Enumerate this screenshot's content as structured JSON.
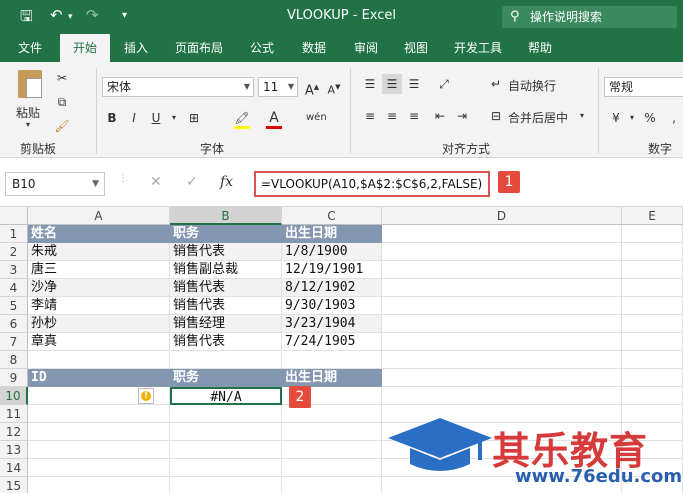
{
  "titlebar": {
    "title": "VLOOKUP  -  Excel",
    "search_placeholder": "操作说明搜索"
  },
  "tabs": [
    "文件",
    "开始",
    "插入",
    "页面布局",
    "公式",
    "数据",
    "审阅",
    "视图",
    "开发工具",
    "帮助"
  ],
  "active_tab": "开始",
  "ribbon": {
    "clipboard": {
      "paste_label": "粘贴",
      "group_label": "剪贴板"
    },
    "font": {
      "font_name": "宋体",
      "font_size": "11",
      "bold": "B",
      "italic": "I",
      "underline": "U",
      "group_label": "字体"
    },
    "alignment": {
      "wrap_text": "自动换行",
      "merge_center": "合并后居中",
      "group_label": "对齐方式"
    },
    "number": {
      "format": "常规",
      "currency": "¥",
      "percent": "%",
      "group_label": "数字"
    }
  },
  "formula_bar": {
    "name_box": "B10",
    "formula": "=VLOOKUP(A10,$A$2:$C$6,2,FALSE)",
    "callout_1": "1"
  },
  "grid": {
    "columns": [
      "A",
      "B",
      "C",
      "D",
      "E"
    ],
    "rows": [
      {
        "n": "1",
        "a": "姓名",
        "b": "职务",
        "c": "出生日期"
      },
      {
        "n": "2",
        "a": "朱戒",
        "b": "销售代表",
        "c": "1/8/1900"
      },
      {
        "n": "3",
        "a": "唐三",
        "b": "销售副总裁",
        "c": "12/19/1901"
      },
      {
        "n": "4",
        "a": "沙净",
        "b": "销售代表",
        "c": "8/12/1902"
      },
      {
        "n": "5",
        "a": "李靖",
        "b": "销售代表",
        "c": "9/30/1903"
      },
      {
        "n": "6",
        "a": "孙杪",
        "b": "销售经理",
        "c": "3/23/1904"
      },
      {
        "n": "7",
        "a": "章真",
        "b": "销售代表",
        "c": "7/24/1905"
      },
      {
        "n": "8",
        "a": "",
        "b": "",
        "c": ""
      },
      {
        "n": "9",
        "a": "ID",
        "b": "职务",
        "c": "出生日期"
      },
      {
        "n": "10",
        "a": "",
        "b": "#N/A",
        "c": ""
      },
      {
        "n": "11",
        "a": "",
        "b": "",
        "c": ""
      },
      {
        "n": "12",
        "a": "",
        "b": "",
        "c": ""
      },
      {
        "n": "13",
        "a": "",
        "b": "",
        "c": ""
      },
      {
        "n": "14",
        "a": "",
        "b": "",
        "c": ""
      },
      {
        "n": "15",
        "a": "",
        "b": "",
        "c": ""
      }
    ],
    "callout_2": "2"
  },
  "watermark": {
    "brand": "其乐教育",
    "url": "www.76edu.com"
  },
  "colors": {
    "excel_green": "#217346",
    "header_fill": "#8497b0",
    "callout_red": "#e44b3c"
  }
}
